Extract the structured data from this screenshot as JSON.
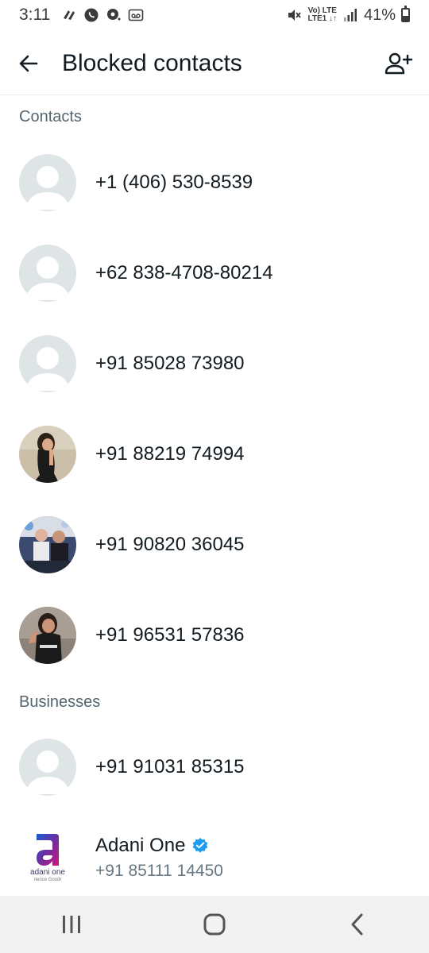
{
  "status_bar": {
    "time": "3:11",
    "network_top": "Vo) LTE",
    "network_bottom": "LTE1 ↓↑",
    "battery_percent": "41%",
    "battery_level": 0.41
  },
  "header": {
    "title": "Blocked contacts",
    "back_icon": "arrow-back-icon",
    "add_icon": "add-contact-icon"
  },
  "sections": {
    "contacts_label": "Contacts",
    "businesses_label": "Businesses"
  },
  "contacts": [
    {
      "name": "+1 (406) 530-8539",
      "avatar": "default"
    },
    {
      "name": "+62 838-4708-80214",
      "avatar": "default"
    },
    {
      "name": "+91 85028 73980",
      "avatar": "default"
    },
    {
      "name": "+91 88219 74994",
      "avatar": "photo"
    },
    {
      "name": "+91 90820 36045",
      "avatar": "photo"
    },
    {
      "name": "+91 96531 57836",
      "avatar": "photo"
    }
  ],
  "businesses": [
    {
      "name": "+91 91031 85315",
      "avatar": "default"
    },
    {
      "name": "Adani One",
      "phone": "+91 85111 14450",
      "verified": true,
      "logo_text": "adani one",
      "logo_tagline": "rience Goodr"
    }
  ],
  "colors": {
    "default_avatar_bg": "#dfe5e7",
    "default_avatar_fg": "#ffffff",
    "verified_badge": "#1d9bf0",
    "adani_purple": "#6b2fa0",
    "adani_pink": "#d1157a"
  },
  "nav": {
    "recents_icon": "recents-icon",
    "home_icon": "home-icon",
    "back_icon": "nav-back-icon"
  }
}
